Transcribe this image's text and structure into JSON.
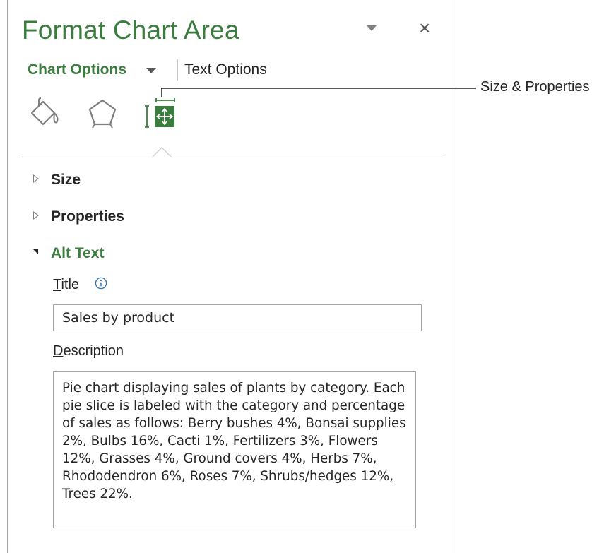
{
  "pane": {
    "title": "Format Chart Area",
    "menu_icon": "caret-down-icon",
    "close_label": "×"
  },
  "tabs": {
    "chart_options": "Chart Options",
    "text_options": "Text Options",
    "active": "Chart Options"
  },
  "toolbar": {
    "icons": [
      "fill-line-icon",
      "effects-icon",
      "size-properties-icon"
    ],
    "selected": "size-properties-icon"
  },
  "callout": {
    "label": "Size & Properties"
  },
  "sections": {
    "size": "Size",
    "properties": "Properties",
    "alt_text": "Alt Text"
  },
  "alt_text": {
    "title_label_first": "T",
    "title_label_rest": "itle",
    "title_value": "Sales by product",
    "description_label_first": "D",
    "description_label_rest": "escription",
    "description_value": "Pie chart displaying sales of plants by category. Each pie slice is labeled with the category and percentage of sales as follows: Berry bushes 4%, Bonsai supplies 2%, Bulbs 16%, Cacti 1%, Fertilizers 3%, Flowers 12%, Grasses 4%, Ground covers 4%, Herbs 7%, Rhododendron 6%, Roses 7%, Shrubs/hedges 12%, Trees 22%."
  },
  "colors": {
    "accent": "#3a7d3e",
    "text": "#262626",
    "border": "#a6a6a6"
  }
}
